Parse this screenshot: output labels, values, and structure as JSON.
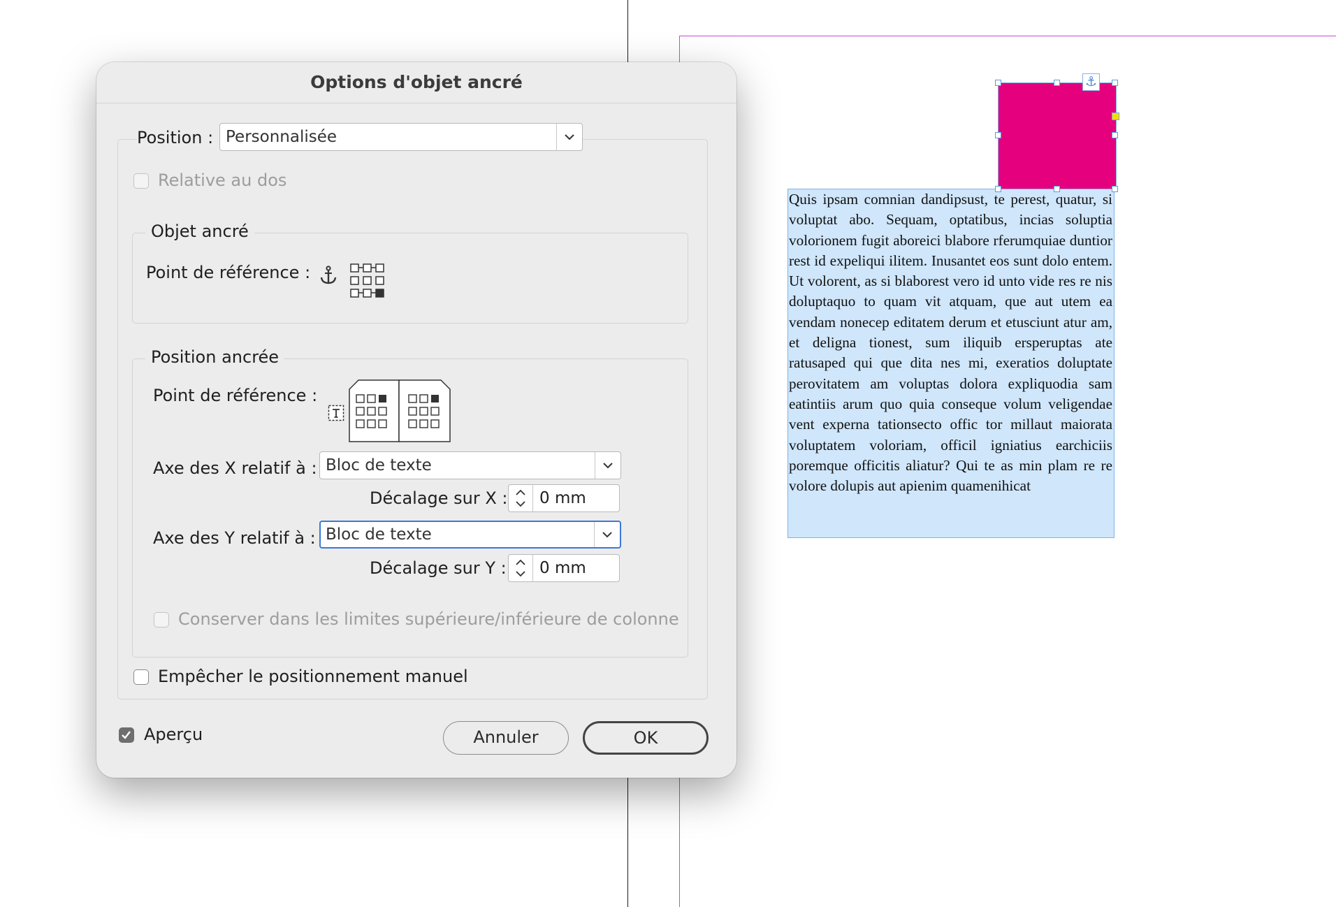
{
  "dialog": {
    "title": "Options d'objet ancré",
    "position": {
      "label": "Position :",
      "value": "Personnalisée"
    },
    "relative_spine": {
      "label": "Relative au dos",
      "checked": false,
      "enabled": false
    },
    "anchored_object": {
      "legend": "Objet ancré",
      "reference_point_label": "Point de référence :",
      "anchor_icon": "anchor-icon"
    },
    "anchored_position": {
      "legend": "Position ancrée",
      "reference_point_label": "Point de référence :",
      "x_relative_label": "Axe des X relatif à :",
      "x_relative_value": "Bloc de texte",
      "x_offset_label": "Décalage sur X :",
      "x_offset_value": "0 mm",
      "y_relative_label": "Axe des Y relatif à :",
      "y_relative_value": "Bloc de texte",
      "y_offset_label": "Décalage sur Y :",
      "y_offset_value": "0 mm",
      "keep_within_label": "Conserver dans les limites supérieure/inférieure de colonne",
      "keep_within_checked": false,
      "keep_within_enabled": false
    },
    "prevent_manual": {
      "label": "Empêcher le positionnement manuel",
      "checked": false
    },
    "preview": {
      "label": "Aperçu",
      "checked": true
    },
    "cancel_label": "Annuler",
    "ok_label": "OK"
  },
  "canvas": {
    "frame_color": "#e5007d",
    "text_frame_color": "#cfe6fb",
    "margin_color": "#c54bd6",
    "body_text": "Quis ipsam comnian dandipsust, te perest, quatur, si voluptat abo. Sequam, optatibus, incias soluptia volorionem fugit aboreici blabore rferumquiae duntior rest id expeliqui ilitem. Inusantet eos sunt dolo entem. Ut volorent, as si blaborest vero id unto vide res re nis doluptaquo to quam vit atquam, que aut utem ea vendam nonecep editatem derum et etusciunt atur am, et deligna tionest, sum iliquib ersperuptas ate ratusaped qui que dita nes mi, exeratios doluptate perovitatem am voluptas dolora expliquodia sam eatintiis arum quo quia conseque volum veligendae vent experna tationsecto offic tor millaut maiorata voluptatem voloriam, officil igniatius earchiciis poremque officitis aliatur? Qui te as min plam re re volore dolupis aut apienim quamenihicat"
  }
}
